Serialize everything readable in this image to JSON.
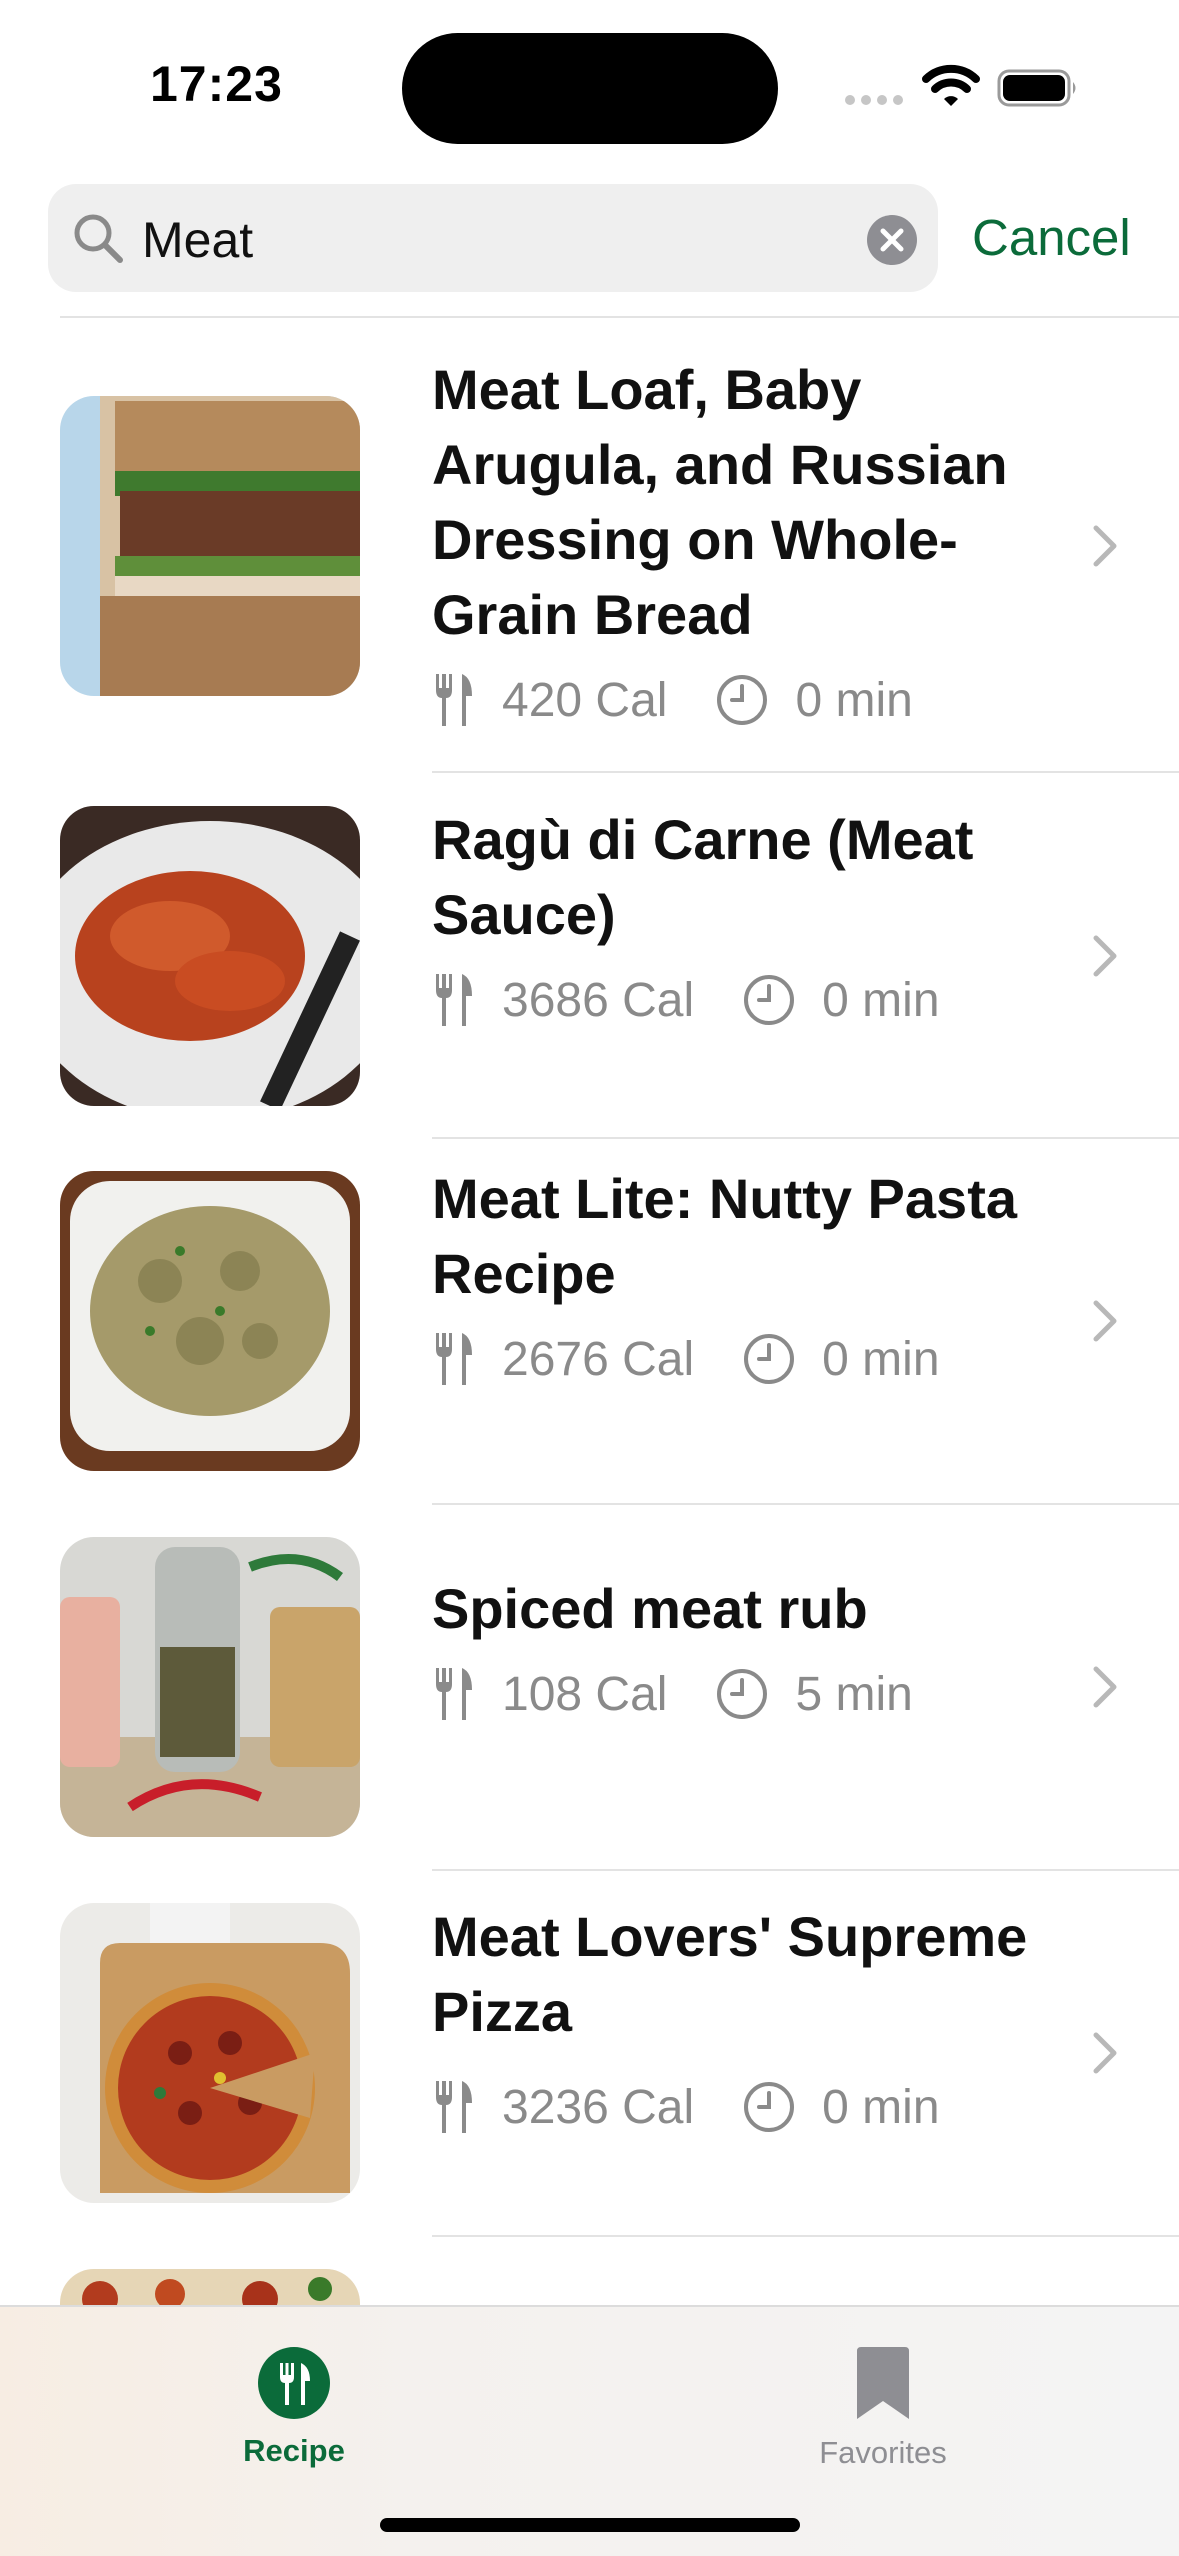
{
  "status_bar": {
    "time": "17:23"
  },
  "search": {
    "value": "Meat",
    "cancel_label": "Cancel"
  },
  "recipes": [
    {
      "title": "Meat Loaf, Baby Arugula, and Russian Dressing on Whole-Grain Bread",
      "calories": "420 Cal",
      "time": "0 min"
    },
    {
      "title": "Ragù di Carne (Meat Sauce)",
      "calories": "3686 Cal",
      "time": "0 min"
    },
    {
      "title": "Meat Lite: Nutty Pasta Recipe",
      "calories": "2676 Cal",
      "time": "0 min"
    },
    {
      "title": "Spiced meat rub",
      "calories": "108 Cal",
      "time": "5 min"
    },
    {
      "title": "Meat Lovers' Supreme Pizza",
      "calories": "3236 Cal",
      "time": "0 min"
    }
  ],
  "tabs": [
    {
      "label": "Recipe",
      "icon": "fork-knife-icon",
      "active": true
    },
    {
      "label": "Favorites",
      "icon": "bookmark-icon",
      "active": false
    }
  ],
  "colors": {
    "accent": "#0b6b3a",
    "inactive": "#8e8e93"
  }
}
